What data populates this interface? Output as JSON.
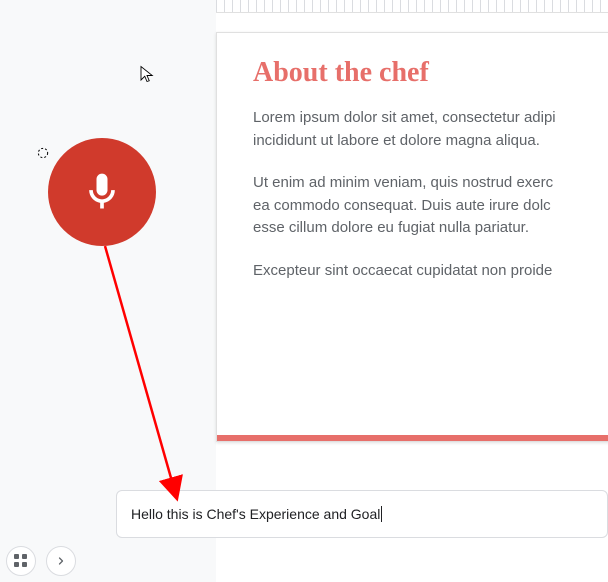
{
  "doc": {
    "title": "About the chef",
    "p1": "Lorem ipsum dolor sit amet, consectetur adipi incididunt ut labore et dolore magna aliqua.",
    "p2": "Ut enim ad minim veniam, quis nostrud exerc ea commodo consequat. Duis aute irure dolc esse cillum dolore eu fugiat nulla pariatur.",
    "p3": "Excepteur sint occaecat cupidatat non proide"
  },
  "voice_input": {
    "text": "Hello this is Chef's Experience and Goal"
  },
  "icons": {
    "mic": "microphone-icon",
    "grid": "grid-icon",
    "next": "chevron-right-icon"
  }
}
